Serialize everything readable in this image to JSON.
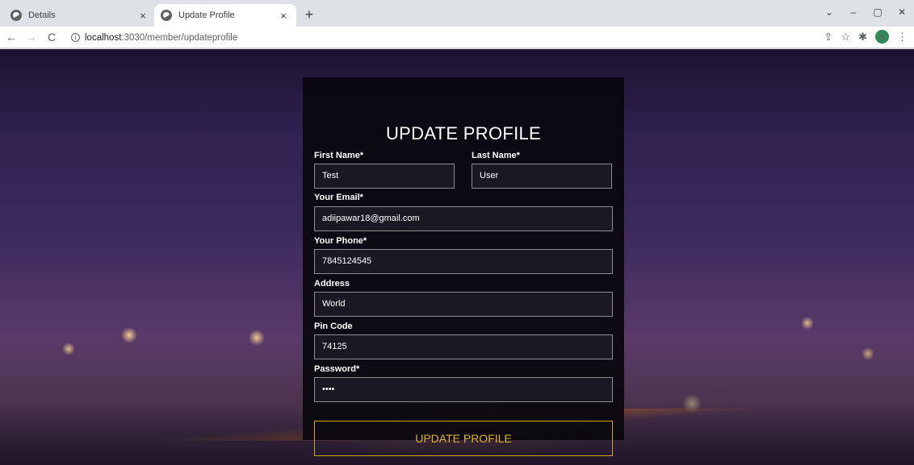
{
  "browser": {
    "tabs": [
      {
        "title": "Details",
        "close": "×"
      },
      {
        "title": "Update Profile",
        "close": "×"
      }
    ],
    "new_tab": "+",
    "window_controls": {
      "dropdown": "⌄",
      "minimize": "–",
      "maximize": "▢",
      "close": "✕"
    },
    "nav": {
      "back": "←",
      "forward": "→",
      "reload": "C"
    },
    "url_host": "localhost",
    "url_path": ":3030/member/updateprofile",
    "toolbar_icons": {
      "share": "⇪",
      "star": "☆",
      "extensions": "✱",
      "menu": "⋮"
    },
    "profile_initial": "a"
  },
  "form": {
    "title": "UPDATE PROFILE",
    "first_name": {
      "label": "First Name*",
      "value": "Test"
    },
    "last_name": {
      "label": "Last Name*",
      "value": "User"
    },
    "email": {
      "label": "Your Email*",
      "value": "adiipawar18@gmail.com"
    },
    "phone": {
      "label": "Your Phone*",
      "value": "7845124545"
    },
    "address": {
      "label": "Address",
      "value": "World"
    },
    "pin_code": {
      "label": "Pin Code",
      "value": "74125"
    },
    "password": {
      "label": "Password*",
      "value": "••••"
    },
    "submit_label": "UPDATE PROFILE"
  },
  "colors": {
    "accent": "#e3b12a",
    "card_bg": "#0a080e",
    "sky_top": "#1b1430",
    "sky_mid": "#3d2b5e"
  }
}
